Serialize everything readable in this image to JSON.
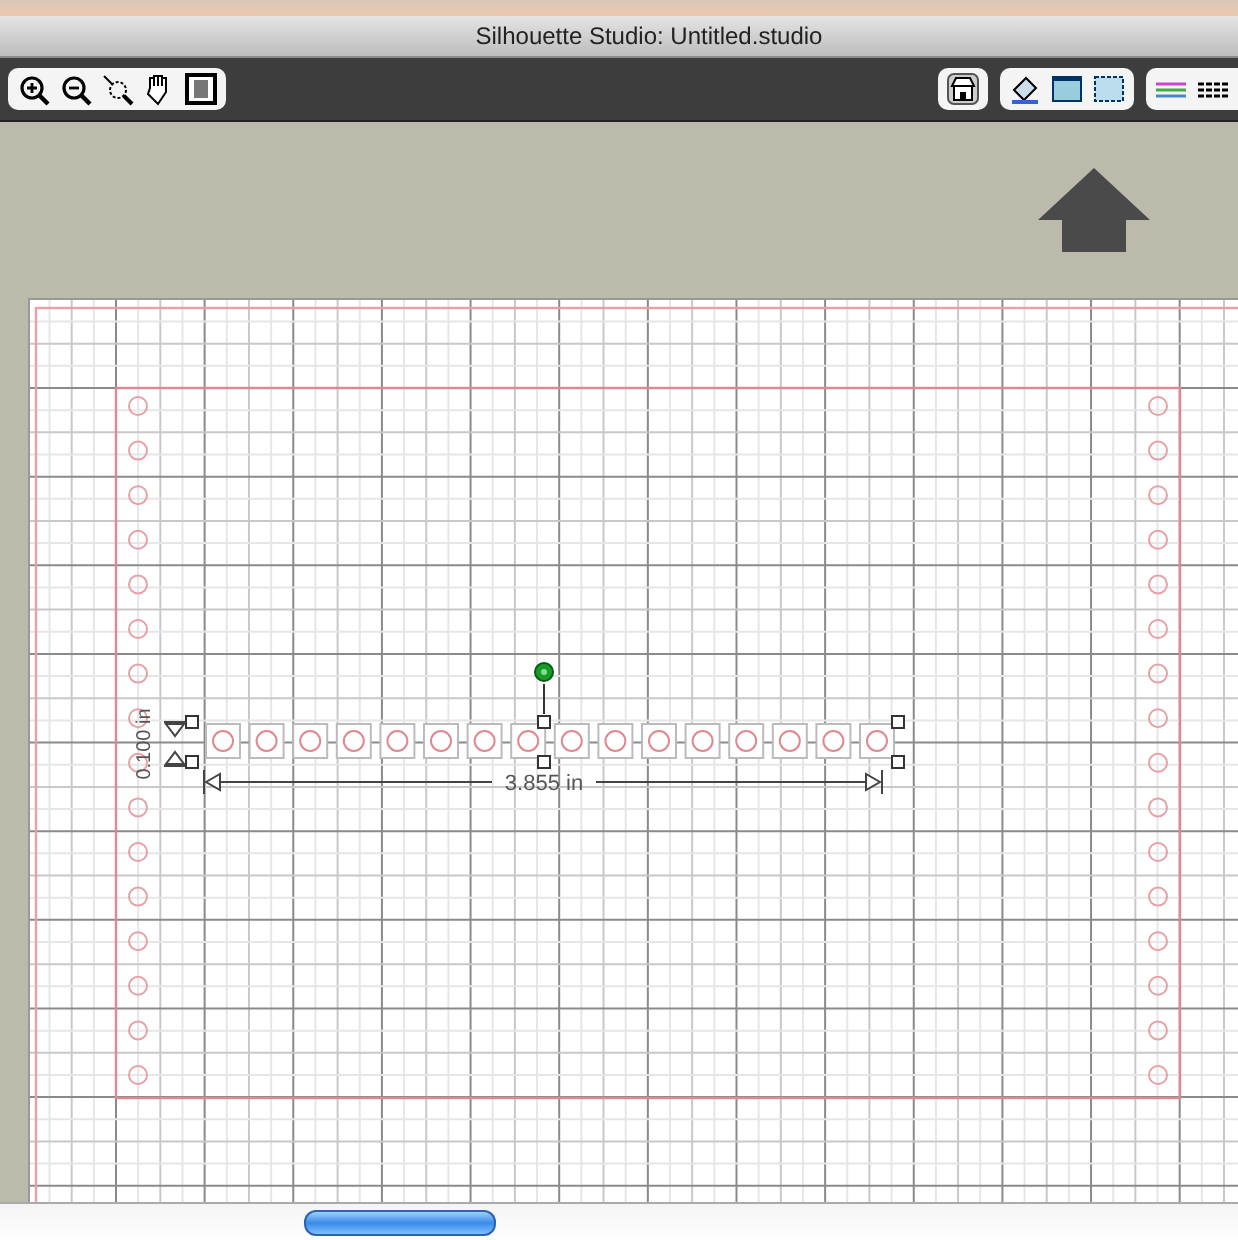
{
  "window": {
    "title": "Silhouette Studio: Untitled.studio"
  },
  "selection": {
    "width_label": "3.855 in",
    "height_label": "0.100 in"
  }
}
